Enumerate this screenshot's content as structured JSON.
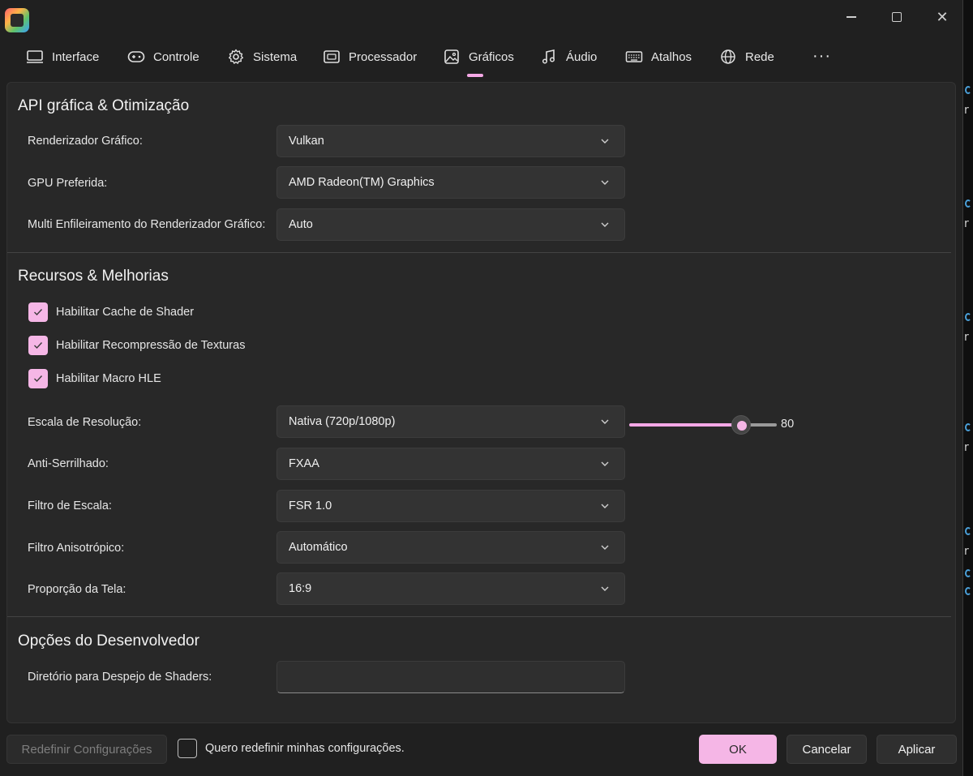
{
  "window": {
    "controls": {
      "close": "✕"
    }
  },
  "tabs": [
    {
      "label": "Interface",
      "icon": "monitor-icon"
    },
    {
      "label": "Controle",
      "icon": "gamepad-icon"
    },
    {
      "label": "Sistema",
      "icon": "gear-icon"
    },
    {
      "label": "Processador",
      "icon": "cpu-icon"
    },
    {
      "label": "Gráficos",
      "icon": "image-icon",
      "active": true
    },
    {
      "label": "Áudio",
      "icon": "music-note-icon"
    },
    {
      "label": "Atalhos",
      "icon": "keyboard-icon"
    },
    {
      "label": "Rede",
      "icon": "globe-icon"
    }
  ],
  "more_label": "···",
  "sections": {
    "api": {
      "title": "API gráfica & Otimização",
      "renderer": {
        "label": "Renderizador Gráfico:",
        "value": "Vulkan"
      },
      "gpu": {
        "label": "GPU Preferida:",
        "value": "AMD Radeon(TM) Graphics"
      },
      "multithread": {
        "label": "Multi Enfileiramento do Renderizador Gráfico:",
        "value": "Auto"
      }
    },
    "features": {
      "title": "Recursos & Melhorias",
      "checks": [
        {
          "label": "Habilitar Cache de Shader",
          "checked": true
        },
        {
          "label": "Habilitar Recompressão de Texturas",
          "checked": true
        },
        {
          "label": "Habilitar Macro HLE",
          "checked": true
        }
      ],
      "resolution": {
        "label": "Escala de Resolução:",
        "value": "Nativa (720p/1080p)"
      },
      "antialias": {
        "label": "Anti-Serrilhado:",
        "value": "FXAA"
      },
      "scaling_filter": {
        "label": "Filtro de Escala:",
        "value": "FSR 1.0",
        "slider_value": 80,
        "slider_display": "80",
        "slider_max": 100
      },
      "anisotropic": {
        "label": "Filtro Anisotrópico:",
        "value": "Automático"
      },
      "aspect": {
        "label": "Proporção da Tela:",
        "value": "16:9"
      }
    },
    "developer": {
      "title": "Opções do Desenvolvedor",
      "shader_dump": {
        "label": "Diretório para Despejo de Shaders:",
        "value": ""
      }
    }
  },
  "footer": {
    "reset_label": "Redefinir Configurações",
    "confirm_label": "Quero redefinir minhas configurações.",
    "ok_label": "OK",
    "cancel_label": "Cancelar",
    "apply_label": "Aplicar"
  },
  "colors": {
    "accent": "#f5b6e6",
    "background": "#202020",
    "panel": "#282828"
  }
}
